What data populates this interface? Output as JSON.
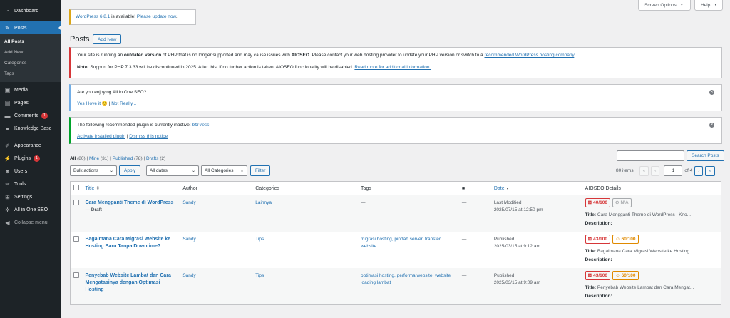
{
  "sidebar": {
    "dashboard": "Dashboard",
    "posts": "Posts",
    "sub": [
      "All Posts",
      "Add New",
      "Categories",
      "Tags"
    ],
    "media": "Media",
    "pages": "Pages",
    "comments": "Comments",
    "comments_badge": "1",
    "kb": "Knowledge Base",
    "appearance": "Appearance",
    "plugins": "Plugins",
    "plugins_badge": "1",
    "users": "Users",
    "tools": "Tools",
    "settings": "Settings",
    "aioseo": "All in One SEO",
    "collapse": "Collapse menu"
  },
  "top": {
    "screen_options": "Screen Options",
    "help": "Help"
  },
  "update": {
    "link1": "WordPress 6.8.1",
    "mid": " is available! ",
    "link2": "Please update now",
    "end": "."
  },
  "page": {
    "title": "Posts",
    "add_new": "Add New"
  },
  "php_notice": {
    "l1_a": "Your site is running an ",
    "l1_b": "outdated version",
    "l1_c": " of PHP that is no longer supported and may cause issues with ",
    "l1_d": "AIOSEO",
    "l1_e": ". Please contact your web hosting provider to update your PHP version or switch to a ",
    "l1_link": "recommended WordPress hosting company",
    "l1_end": ".",
    "l2_a": "Note:",
    "l2_b": " Support for PHP 7.3.33 will be discontinued in 2025. After this, if no further action is taken, AIOSEO functionality will be disabled. ",
    "l2_link": "Read more for additional information."
  },
  "enjoy_notice": {
    "q": "Are you enjoying All in One SEO?",
    "yes": "Yes I love it",
    "emoji": "🙂",
    "sep": " | ",
    "no": "Not Really..."
  },
  "plugin_notice": {
    "a": "The following recommended plugin is currently inactive: ",
    "plugin": "bbPress",
    "end": ".",
    "activate": "Activate installed plugin",
    "sep": " | ",
    "dismiss": "Dismiss this notice"
  },
  "filters": {
    "all": "All",
    "all_count": "(80)",
    "mine": "Mine",
    "mine_count": "(31)",
    "published": "Published",
    "published_count": "(78)",
    "drafts": "Drafts",
    "drafts_count": "(2)",
    "bulk": "Bulk actions",
    "apply": "Apply",
    "dates": "All dates",
    "categories": "All Categories",
    "filter": "Filter",
    "search_btn": "Search Posts",
    "items": "80 items",
    "first": "«",
    "prev": "‹",
    "page": "1",
    "of": "of 4",
    "next": "›",
    "last": "»"
  },
  "columns": {
    "title": "Title",
    "author": "Author",
    "categories": "Categories",
    "tags": "Tags",
    "date": "Date",
    "aioseo": "AIOSEO Details"
  },
  "rows": [
    {
      "title": "Cara Mengganti Theme di WordPress",
      "state": " — Draft",
      "author": "Sandy",
      "category": "Lainnya",
      "tags": "—",
      "comments": "—",
      "status": "Last Modified",
      "date": "2025/07/15 at 12:50 pm",
      "score1": "40/100",
      "score2": "N/A",
      "seo_title": "Cara Mengganti Theme di WordPress | Kno...",
      "desc_label": "Description:",
      "title_label": "Title:"
    },
    {
      "title": "Bagaimana Cara Migrasi Website ke Hosting Baru Tanpa Downtime?",
      "state": "",
      "author": "Sandy",
      "category": "Tips",
      "tags": "migrasi hosting, pindah server, transfer website",
      "comments": "—",
      "status": "Published",
      "date": "2025/03/15 at 9:12 am",
      "score1": "43/100",
      "score2": "60/100",
      "seo_title": "Bagaimana Cara Migrasi Website ke Hosting...",
      "desc_label": "Description:",
      "title_label": "Title:"
    },
    {
      "title": "Penyebab Website Lambat dan Cara Mengatasinya dengan Optimasi Hosting",
      "state": "",
      "author": "Sandy",
      "category": "Tips",
      "tags": "optimasi hosting, performa website, website loading lambat",
      "comments": "—",
      "status": "Published",
      "date": "2025/03/15 at 9:09 am",
      "score1": "43/100",
      "score2": "60/100",
      "seo_title": "Penyebab Website Lambat dan Cara Mengat...",
      "desc_label": "Description:",
      "title_label": "Title:"
    }
  ]
}
